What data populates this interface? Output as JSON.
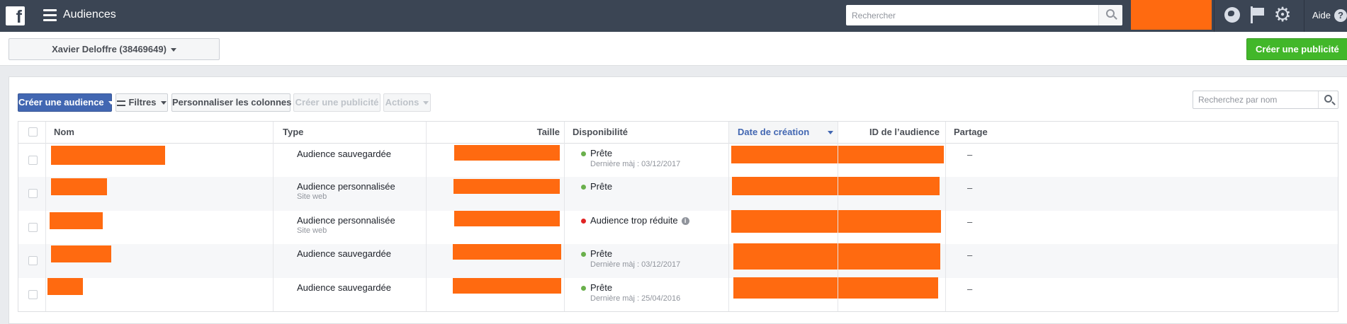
{
  "topbar": {
    "app_title": "Audiences",
    "search_placeholder": "Rechercher",
    "help_label": "Aide"
  },
  "account": {
    "name": "Xavier Deloffre (38469649)",
    "create_ad_label": "Créer une publicité"
  },
  "toolbar": {
    "create_audience_label": "Créer une audience",
    "filters_label": "Filtres",
    "customize_columns_label": "Personnaliser les colonnes",
    "create_ad_label": "Créer une publicité",
    "actions_label": "Actions",
    "search_name_placeholder": "Recherchez par nom"
  },
  "table": {
    "columns": {
      "name": "Nom",
      "type": "Type",
      "size": "Taille",
      "availability": "Disponibilité",
      "created": "Date de création",
      "audience_id": "ID de l’audience",
      "sharing": "Partage"
    },
    "rows": [
      {
        "type": "Audience sauvegardée",
        "type_sub": "",
        "status": "Prête",
        "status_color": "#6ab04c",
        "last_update": "Dernière màj : 03/12/2017",
        "sharing": "–"
      },
      {
        "type": "Audience personnalisée",
        "type_sub": "Site web",
        "status": "Prête",
        "status_color": "#6ab04c",
        "last_update": "",
        "sharing": "–"
      },
      {
        "type": "Audience personnalisée",
        "type_sub": "Site web",
        "status": "Audience trop réduite",
        "status_color": "#e02424",
        "last_update": "",
        "sharing": "–"
      },
      {
        "type": "Audience sauvegardée",
        "type_sub": "",
        "status": "Prête",
        "status_color": "#6ab04c",
        "last_update": "Dernière màj : 03/12/2017",
        "sharing": "–"
      },
      {
        "type": "Audience sauvegardée",
        "type_sub": "",
        "status": "Prête",
        "status_color": "#6ab04c",
        "last_update": "Dernière màj : 25/04/2016",
        "sharing": "–"
      }
    ]
  },
  "colors": {
    "topbar": "#3b4554",
    "primary": "#4267b2",
    "success": "#42b72a",
    "redaction": "#ff6a10"
  },
  "icons": [
    "facebook-logo-icon",
    "menu-icon",
    "search-icon",
    "globe-icon",
    "flag-icon",
    "gear-icon",
    "help-icon",
    "caret-down-icon",
    "filter-icon",
    "info-icon"
  ]
}
